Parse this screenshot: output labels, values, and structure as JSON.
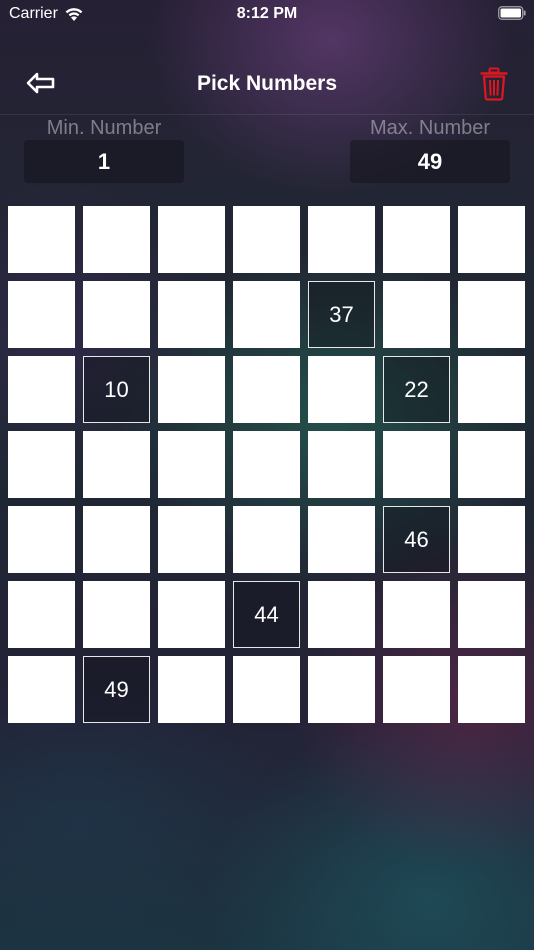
{
  "status_bar": {
    "carrier": "Carrier",
    "time": "8:12 PM"
  },
  "nav": {
    "title": "Pick Numbers",
    "back_icon": "back-arrow-icon",
    "delete_icon": "trash-icon",
    "delete_color": "#e0161e"
  },
  "range": {
    "min_label": "Min. Number",
    "min_value": "1",
    "max_label": "Max. Number",
    "max_value": "49"
  },
  "grid": {
    "columns": 7,
    "rows": 7,
    "cells": [
      "",
      "",
      "",
      "",
      "",
      "",
      "",
      "",
      "",
      "",
      "",
      "37",
      "",
      "",
      "",
      "10",
      "",
      "",
      "",
      "22",
      "",
      "",
      "",
      "",
      "",
      "",
      "",
      "",
      "",
      "",
      "",
      "",
      "",
      "46",
      "",
      "",
      "",
      "",
      "44",
      "",
      "",
      "",
      "",
      "49",
      "",
      "",
      "",
      "",
      ""
    ]
  }
}
